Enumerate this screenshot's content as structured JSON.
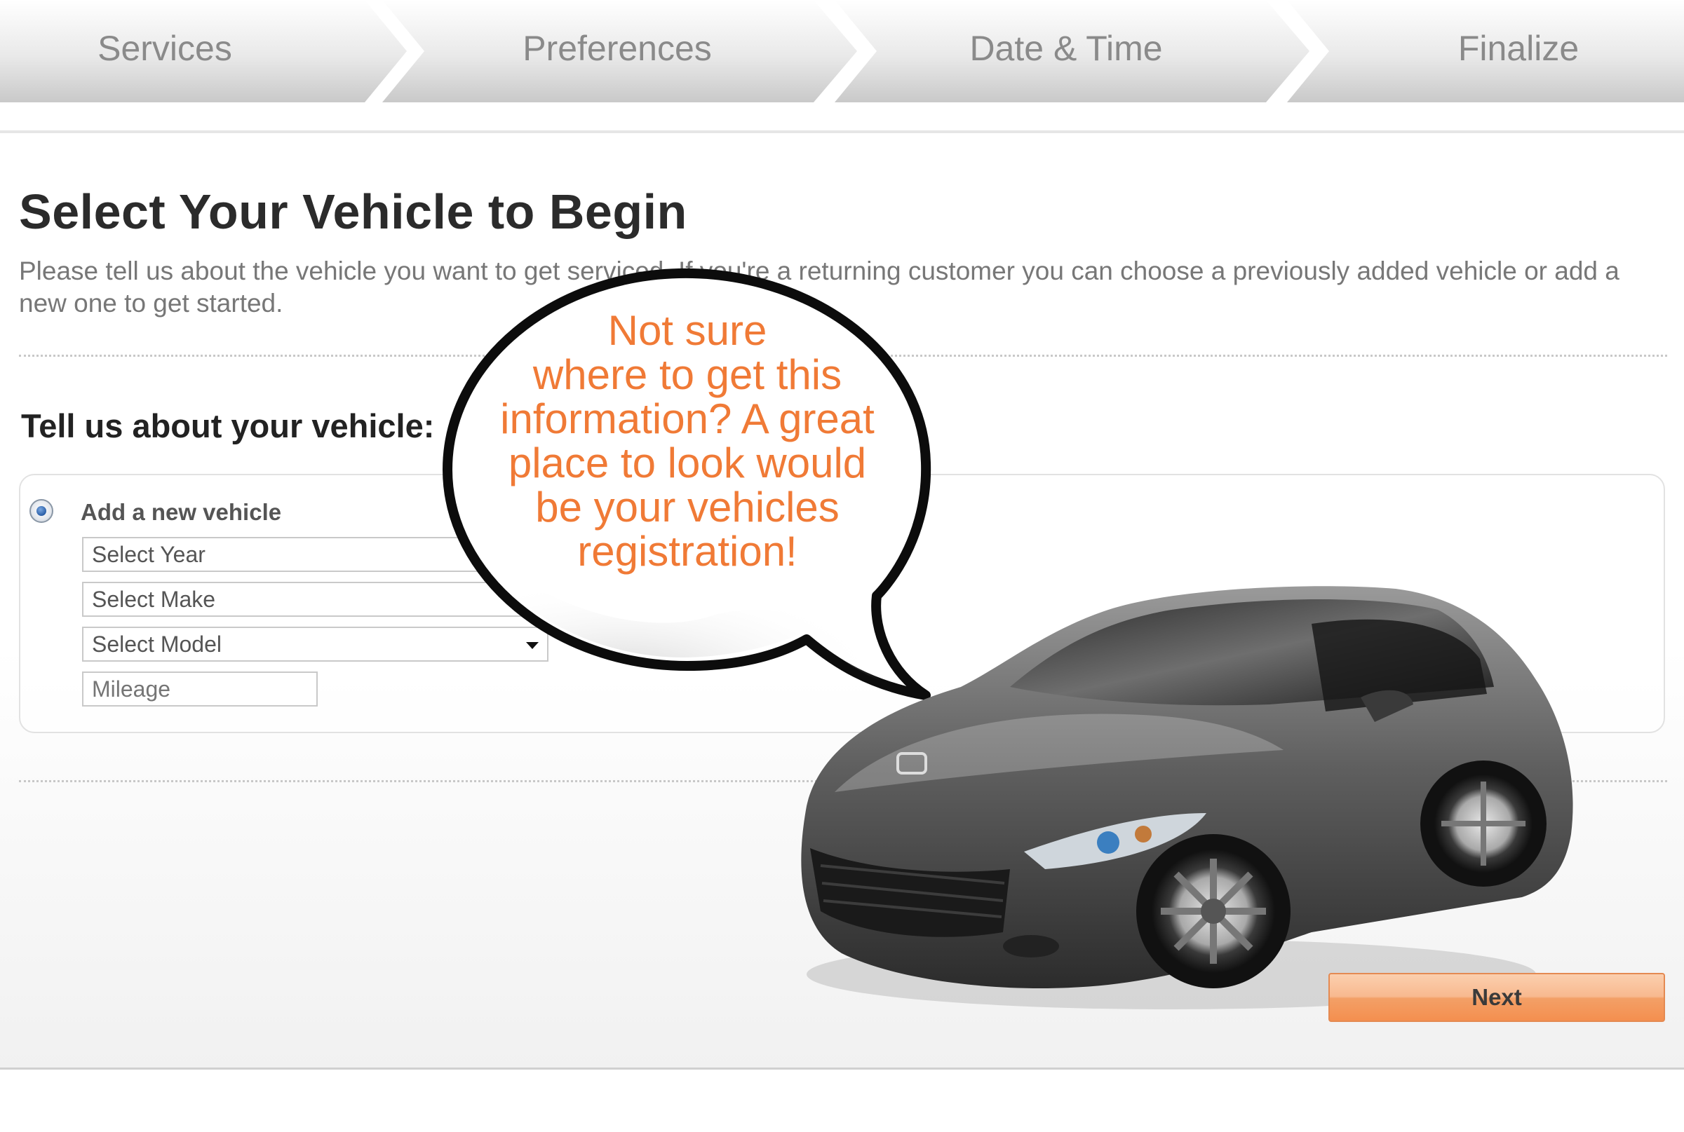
{
  "steps": [
    {
      "label": "Services"
    },
    {
      "label": "Preferences"
    },
    {
      "label": "Date & Time"
    },
    {
      "label": "Finalize"
    }
  ],
  "page": {
    "title": "Select Your Vehicle to Begin",
    "intro": "Please tell us about the vehicle you want to get serviced. If you're a returning customer you can choose a previously added vehicle or add a new one to get started."
  },
  "vehicle_form": {
    "heading": "Tell us about your vehicle:",
    "radio_label": "Add a new vehicle",
    "radio_selected": true,
    "year_value": "Select Year",
    "make_value": "Select Make",
    "model_value": "Select Model",
    "mileage_placeholder": "Mileage"
  },
  "callout": {
    "lines": [
      "Not sure",
      "where to get this",
      "information? A great",
      "place to look would",
      "be your vehicles",
      "registration!"
    ],
    "color": "#f07a36"
  },
  "buttons": {
    "next_label": "Next"
  },
  "colors": {
    "accent": "#f48f4f",
    "step_text": "#8a8a8a"
  }
}
